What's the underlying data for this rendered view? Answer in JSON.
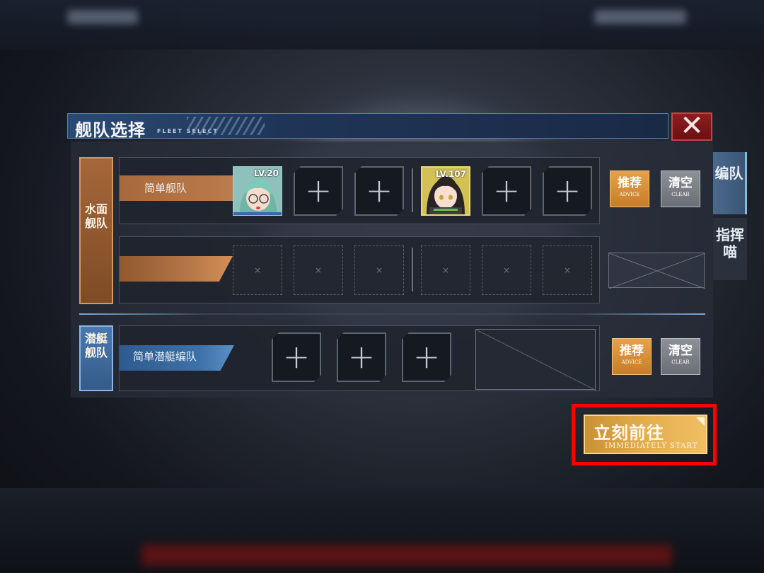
{
  "dialog": {
    "title": "舰队选择",
    "subtitle": "FLEET SELECT",
    "close_symbol": "✕"
  },
  "side_tabs": [
    {
      "label": "编队",
      "active": true
    },
    {
      "label": "指挥喵",
      "active": false
    }
  ],
  "surface_fleet": {
    "group_label": "水面舰队",
    "rows": [
      {
        "name": "简单舰队",
        "slots": [
          {
            "type": "ship",
            "level": "LV.20"
          },
          {
            "type": "add"
          },
          {
            "type": "add"
          },
          {
            "type": "ship",
            "level": "LV.107"
          },
          {
            "type": "add"
          },
          {
            "type": "add"
          }
        ]
      },
      {
        "name": "",
        "slots": [
          {
            "type": "locked"
          },
          {
            "type": "locked"
          },
          {
            "type": "locked"
          },
          {
            "type": "locked"
          },
          {
            "type": "locked"
          },
          {
            "type": "locked"
          }
        ]
      }
    ]
  },
  "submarine_fleet": {
    "group_label": "潜艇舰队",
    "name": "简单潜艇编队",
    "slots": [
      {
        "type": "add"
      },
      {
        "type": "add"
      },
      {
        "type": "add"
      }
    ]
  },
  "buttons": {
    "advice_cn": "推荐",
    "advice_en": "ADVICE",
    "clear_cn": "清空",
    "clear_en": "CLEAR",
    "start_cn": "立刻前往",
    "start_en": "IMMEDIATELY START"
  },
  "glyphs": {
    "plus": "+",
    "locked": "×"
  },
  "colors": {
    "accent_orange": "#c77d28",
    "accent_blue": "#3d71a8",
    "close_red": "#8f1d1f",
    "highlight": "#ff0000"
  }
}
